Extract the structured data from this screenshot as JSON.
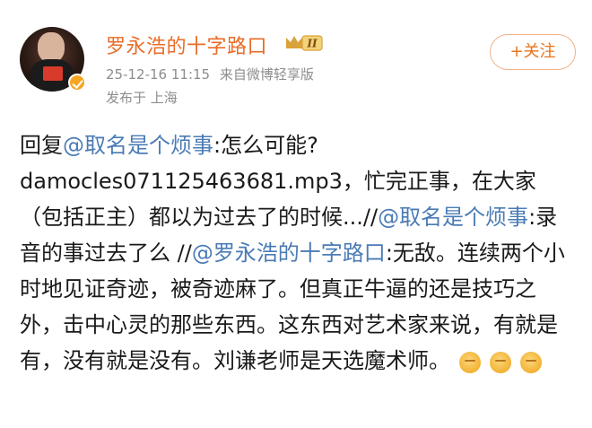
{
  "post": {
    "username": "罗永浩的十字路口",
    "timestamp": "25-12-16 11:15",
    "source": "来自微博轻享版",
    "location": "发布于 上海",
    "follow_label": "+关注",
    "vip_level": "II",
    "body": {
      "reply_prefix": "回复",
      "mention1": "@取名是个烦事",
      "text1": ":怎么可能?",
      "text2": "damocles071125463681.mp3，忙完正事，在大家（包括正主）都以为过去了的时候...//",
      "mention2": "@取名是个烦事",
      "text3": ":录音的事过去了么 //",
      "mention3": "@罗永浩的十字路口",
      "text4": ":无敌。连续两个小时地见证奇迹，被奇迹麻了。但真正牛逼的还是技巧之外，击中心灵的那些东西。这东西对艺术家来说，有就是有，没有就是没有。刘谦老师是天选魔术师。"
    }
  },
  "colors": {
    "username": "#e86c28",
    "mention": "#4a7bb5",
    "meta": "#8d8d8d",
    "follow": "#e8731a"
  },
  "icons": [
    "verified-badge-icon",
    "vip-crown-icon",
    "fist-emoji-icon"
  ]
}
